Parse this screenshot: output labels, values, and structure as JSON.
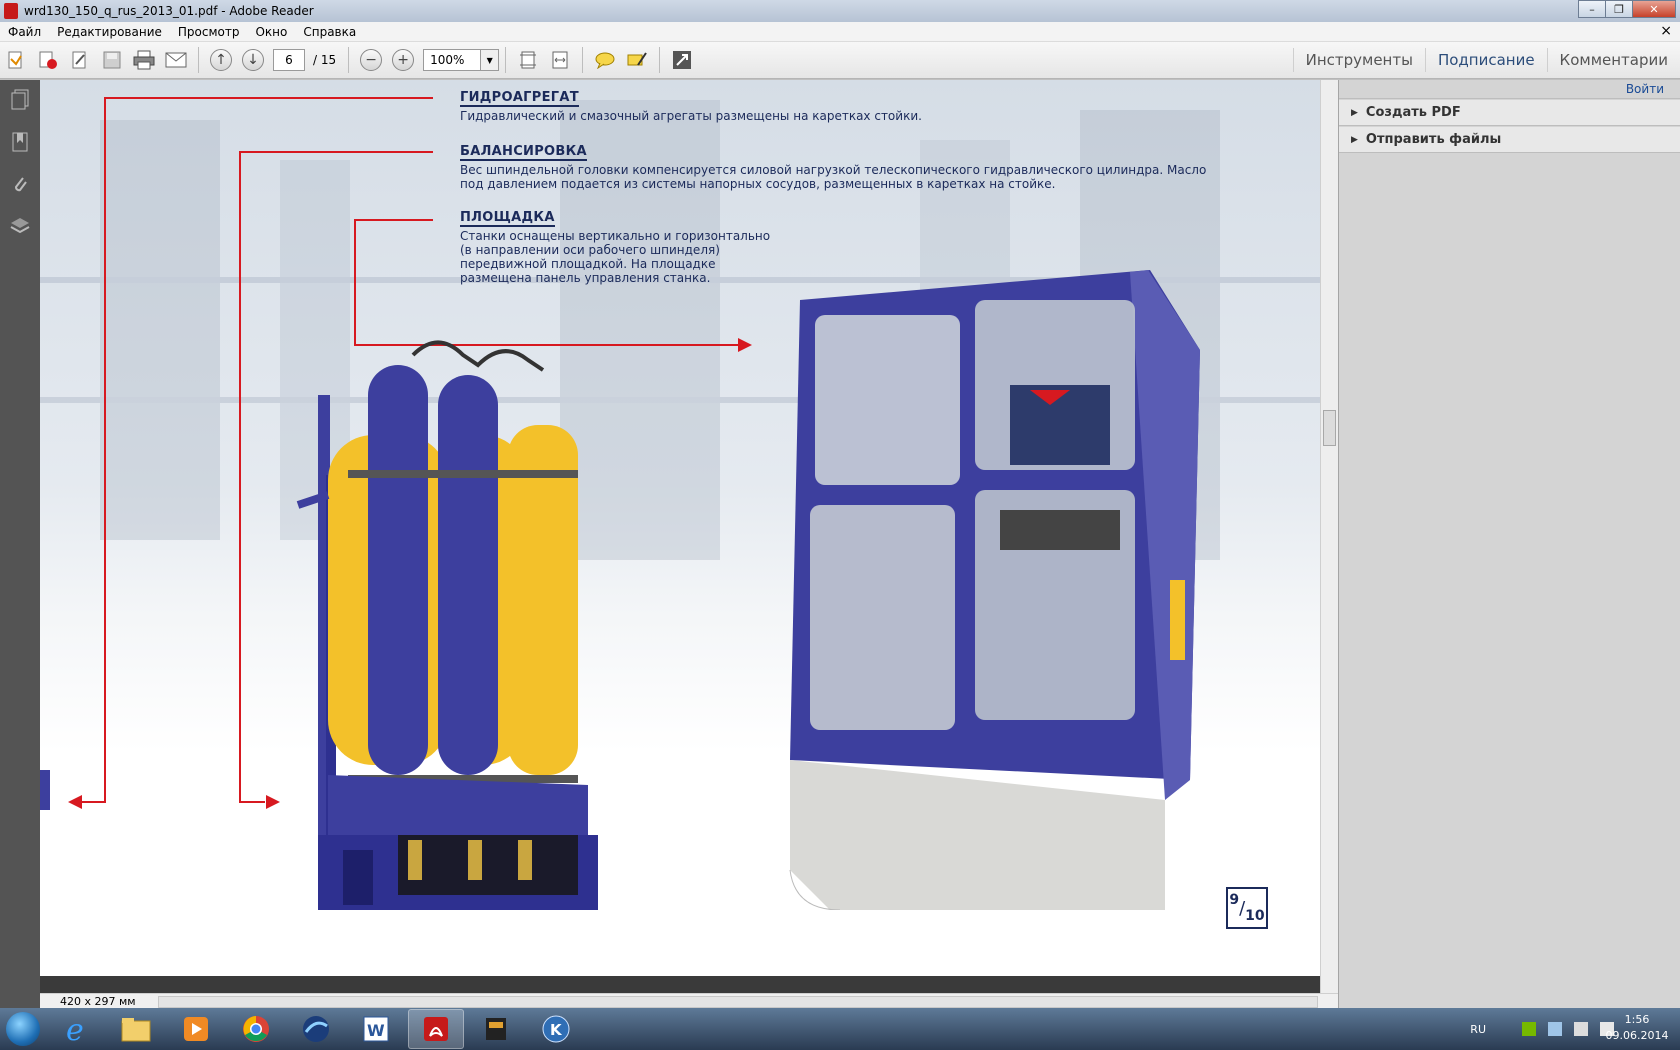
{
  "window": {
    "title": "wrd130_150_q_rus_2013_01.pdf - Adobe Reader",
    "close_label": "✕",
    "min_label": "–",
    "max_label": "❐"
  },
  "menu": {
    "items": [
      "Файл",
      "Редактирование",
      "Просмотр",
      "Окно",
      "Справка"
    ],
    "close_glyph": "×"
  },
  "toolbar": {
    "page_current": "6",
    "page_total": "/ 15",
    "zoom": "100%",
    "tabs": [
      "Инструменты",
      "Подписание",
      "Комментарии"
    ]
  },
  "document": {
    "sections": [
      {
        "title": "ГИДРОАГРЕГАТ",
        "text": "Гидравлический и смазочный агрегаты размещены на каретках стойки."
      },
      {
        "title": "БАЛАНСИРОВКА",
        "text": "Вес шпиндельной головки компенсируется силовой нагрузкой телескопического гидравлического цилиндра. Масло под давлением подается из системы напорных сосудов, размещенных в каретках на стойке."
      },
      {
        "title": "ПЛОЩАДКА",
        "text_lines": [
          "Станки оснащены вертикально и горизонтально",
          "(в направлении оси рабочего шпинделя)",
          "передвижной площадкой. На площадке",
          "размещена панель управления  станка."
        ]
      }
    ],
    "page_number_top": "9",
    "page_number_bottom": "10",
    "page_size": "420 x 297 мм"
  },
  "right_panel": {
    "login": "Войти",
    "items": [
      "Создать PDF",
      "Отправить файлы"
    ]
  },
  "taskbar": {
    "lang": "RU",
    "time": "1:56",
    "date": "09.06.2014"
  },
  "colors": {
    "accent_red": "#d71920",
    "navy": "#1b2a5a",
    "machine_blue": "#3d3f9e",
    "cylinder_yellow": "#f3c12a"
  }
}
